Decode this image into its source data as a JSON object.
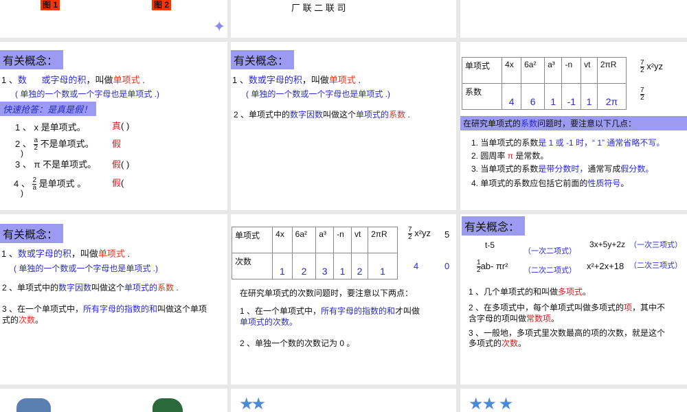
{
  "slide1": {
    "tag1": "图 1",
    "tag2": "图 2"
  },
  "slide2": {
    "caption": "厂 联 二 联 司"
  },
  "slideA": {
    "header": "有关概念：",
    "l1a": "1 、",
    "l1b": "数",
    "l1c": "或字母的积",
    "l1d": "，叫做",
    "l1e": "单项式",
    "l1f": " .",
    "l2": "( 单独的一个数或一个字母也是单项式 .)",
    "quiz": "快速抢答：是真是假！",
    "q": [
      {
        "n": "1 、",
        "expr": "x",
        "text": "是单项式。",
        "ans": "真",
        "paren": "(         )"
      },
      {
        "n": "2 、",
        "num": "a",
        "den": "2",
        "text": "不是单项式。",
        "ans": "假",
        "paren": ")"
      },
      {
        "n": "3 、",
        "expr": "π",
        "text": "不是单项式。",
        "ans": "假",
        "paren": "(         )"
      },
      {
        "n": "4 、",
        "num": "2",
        "den": "a",
        "text": "是单项式 。",
        "ans": "假",
        "paren": "(",
        "paren2": ")"
      }
    ]
  },
  "slideB": {
    "header": "有关概念：",
    "l1a": "1 、",
    "l1b": "数或字母的积",
    "l1c": "，叫做",
    "l1d": "单项式",
    "l1e": " .",
    "l2": "( 单独的一个数或一个字母也是单项式 .)",
    "l3a": "2 、单项式中的",
    "l3b": "数字因数",
    "l3c": "叫做这个",
    "l3d": "单项式的",
    "l3e": "系数",
    "l3f": " ."
  },
  "slideC": {
    "row1": [
      "单项式",
      "4x",
      "6a²",
      "a³",
      "-n",
      "vt",
      "2πR"
    ],
    "row2": [
      "系数",
      "4",
      "6",
      "1",
      "-1",
      "1",
      "2π"
    ],
    "extra_num": "7",
    "extra_den": "2",
    "extra_expr": "x²yz",
    "extra_coef_num": "7",
    "extra_coef_den": "2",
    "banner_a": "在研究单项式的",
    "banner_b": "系数",
    "banner_c": "问题时，要注意以下几点：",
    "p1a": "1. 当单项式的系数",
    "p1b": "是 1 或 -1 时，“ 1” 通常省略不写。",
    "p2a": "2. 圆周率",
    "p2b": "π",
    "p2c": "是常数。",
    "p3a": "3. 当单项式的系数",
    "p3b": "是带分数时，",
    "p3c": "通常写成",
    "p3d": "假分数。",
    "p4a": "4. 单项式的系数应包括它前面的",
    "p4b": "性质符号",
    "p4c": "。"
  },
  "slideD": {
    "header": "有关概念：",
    "l1a": "1 、",
    "l1b": "数或字母的积",
    "l1c": "，叫做",
    "l1d": "单项式",
    "l1e": " .",
    "l2": "( 单独的一个数或一个字母也是单项式 .)",
    "l3a": "2 、单项式中的",
    "l3b": "数字因数",
    "l3c": "叫做这个",
    "l3d": "单项式的",
    "l3e": "系数",
    "l3f": " .",
    "l4a": "3 、在一个单项式中，",
    "l4b": "所有字母的指数的和",
    "l4c": "叫做这个单项",
    "l4d": "式的",
    "l4e": "次数",
    "l4f": "。"
  },
  "slideE": {
    "row1": [
      "单项式",
      "4x",
      "6a²",
      "a³",
      "-n",
      "vt",
      "2πR"
    ],
    "row2": [
      "次数",
      "1",
      "2",
      "3",
      "1",
      "2",
      "1"
    ],
    "extra_num": "7",
    "extra_den": "2",
    "extra_expr": "x²yz",
    "extra5": "5",
    "deg_extra": "4",
    "deg5": "0",
    "intro": "在研究单项式的次数问题时，要注意以下两点：",
    "p1a": "1 、在一个单项式中，",
    "p1b": "所有字母的指数的和",
    "p1c": "才叫做",
    "p1d": "单项式的次数。",
    "p2": "2 、单独一个数的次数记为 0 。"
  },
  "slideF": {
    "header": "有关概念：",
    "e1": "t-5",
    "c1": "（一次二项式）",
    "e2": "3x+5y+2z",
    "c2": "（一次三项式）",
    "e3num": "1",
    "e3den": "2",
    "e3": "ab- πr²",
    "c3": "（二次二项式）",
    "e4": "x²+2x+18",
    "c4": "（二次三项式）",
    "p1a": "1 、几个单项式的和叫做",
    "p1b": "多项式",
    "p1c": "。",
    "p2a": "2 、在多项式中，每个单项式叫做多项式的",
    "p2b": "项",
    "p2c": "，其中不",
    "p2d": "含字母的项叫做",
    "p2e": "常数项",
    "p2f": "。",
    "p3a": "3 、一般地，多项式里次数最高的项的次数，就是这个",
    "p3b": "多项式的",
    "p3c": "次数",
    "p3d": "。"
  }
}
